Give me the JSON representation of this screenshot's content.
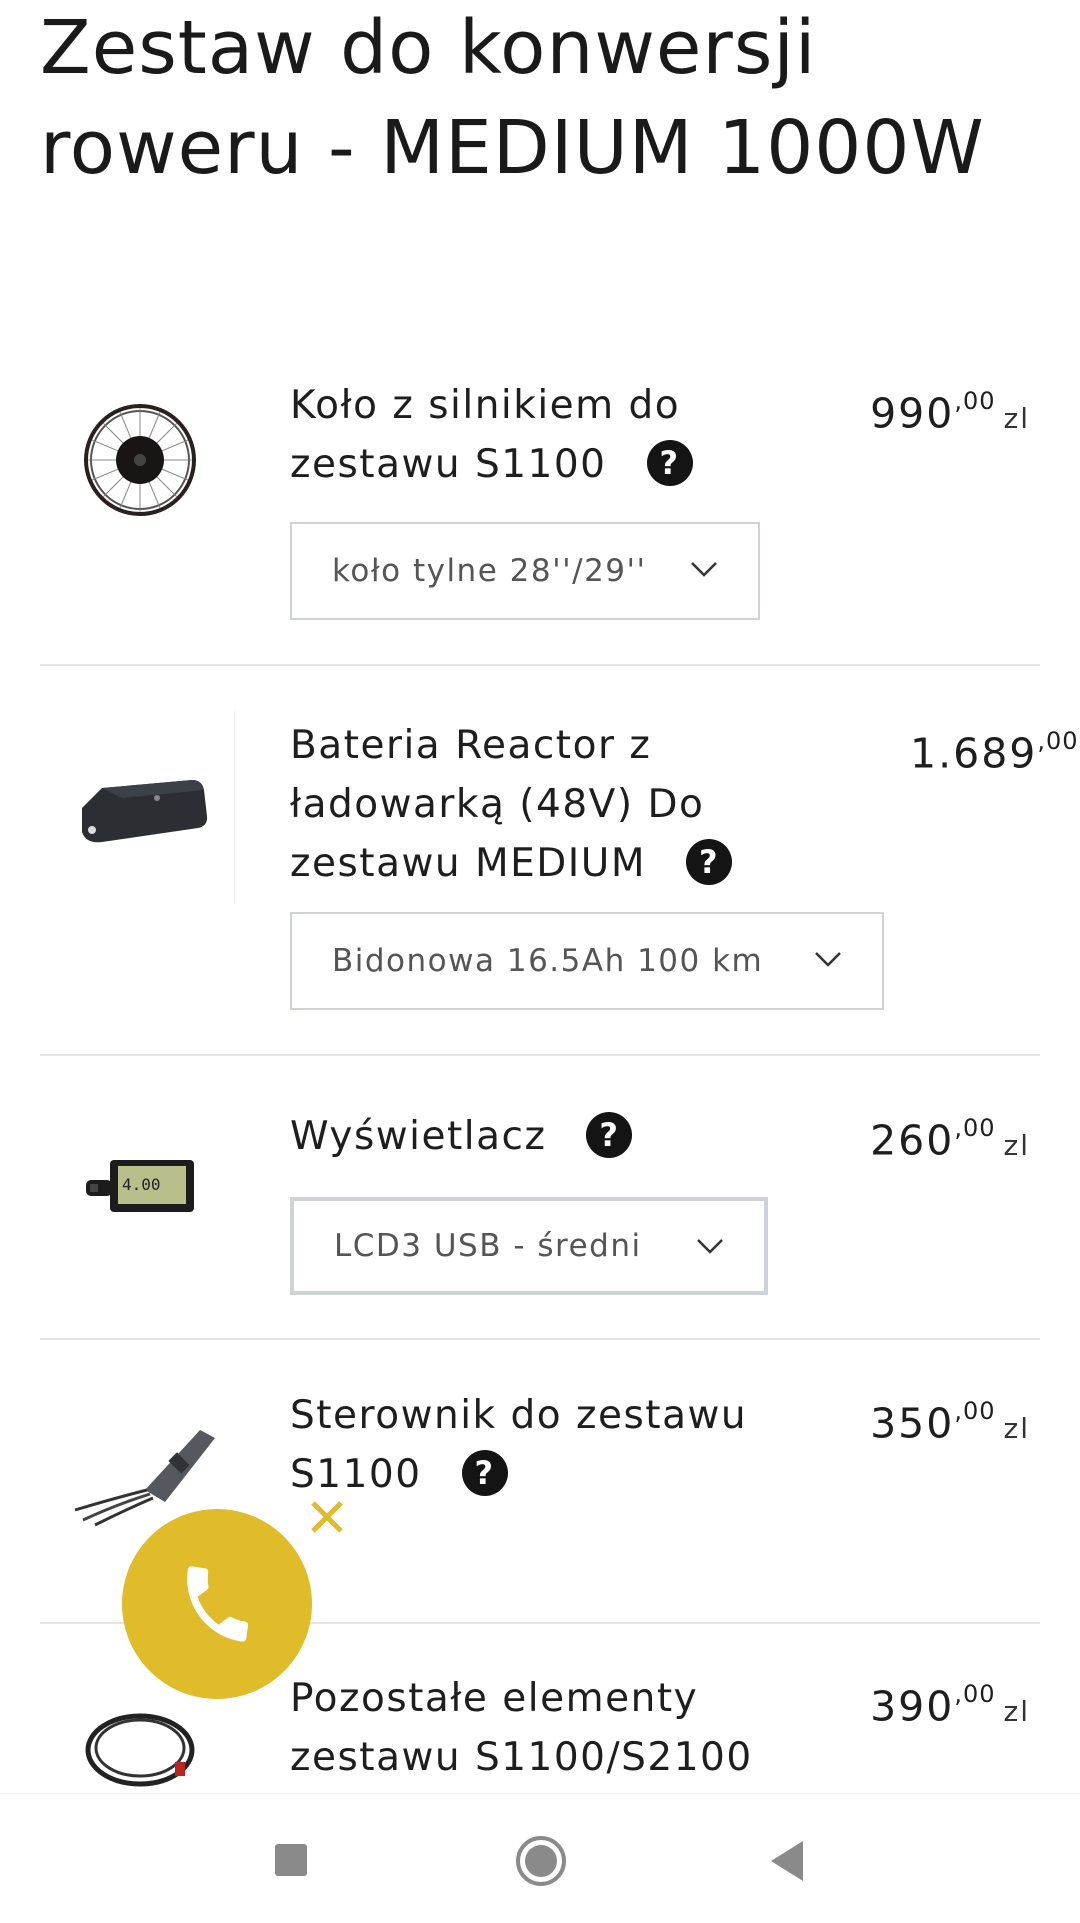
{
  "title": "Zestaw do konwersji roweru - MEDIUM 1000W",
  "products": [
    {
      "name": "Koło z silnikiem do zestawu S1100",
      "price_main": "990",
      "price_decimals": ",00",
      "currency": "zl",
      "option": "koło tylne 28''/29''",
      "image": "wheel-motor-image",
      "help_icon": "?"
    },
    {
      "name": "Bateria Reactor z ładowarką (48V) Do zestawu MEDIUM",
      "price_main": "1.689",
      "price_decimals": ",00",
      "currency": "",
      "option": "Bidonowa 16.5Ah 100 km",
      "image": "battery-image",
      "help_icon": "?"
    },
    {
      "name": "Wyświetlacz",
      "price_main": "260",
      "price_decimals": ",00",
      "currency": "zl",
      "option": "LCD3 USB - średni",
      "image": "display-image",
      "help_icon": "?"
    },
    {
      "name": "Sterownik do zestawu S1100",
      "price_main": "350",
      "price_decimals": ",00",
      "currency": "zl",
      "image": "controller-image",
      "help_icon": "?"
    },
    {
      "name": "Pozostałe elementy zestawu S1100/S2100",
      "price_main": "390",
      "price_decimals": ",00",
      "currency": "zl",
      "image": "cable-image"
    }
  ],
  "floating": {
    "call_icon": "phone-icon",
    "close_icon": "close-icon",
    "accent_color": "#e0bb2a"
  },
  "navbar": {
    "recents_icon": "square-icon",
    "home_icon": "circle-icon",
    "back_icon": "triangle-back-icon"
  }
}
